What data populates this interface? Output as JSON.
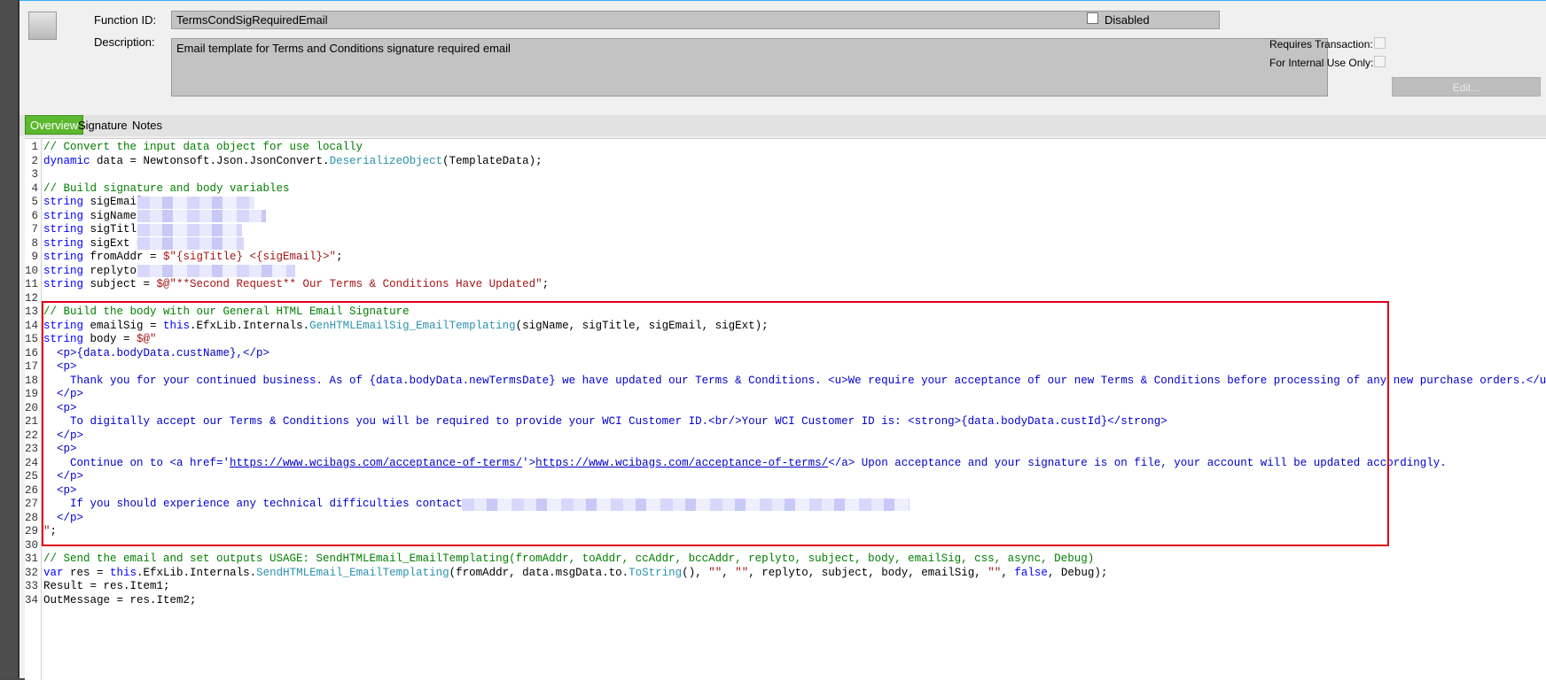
{
  "header": {
    "function_id_label": "Function ID:",
    "function_id_value": "TermsCondSigRequiredEmail",
    "disabled_label": "Disabled",
    "description_label": "Description:",
    "description_value": "Email template for Terms and Conditions signature required email",
    "requires_transaction_label": "Requires Transaction:",
    "internal_use_label": "For Internal Use Only:",
    "edit_button_label": "Edit..."
  },
  "tabs": [
    {
      "label": "Overview",
      "active": true
    },
    {
      "label": "Signature",
      "active": false
    },
    {
      "label": "Notes",
      "active": false
    }
  ],
  "code_lines": [
    {
      "n": "1"
    },
    {
      "n": "2"
    },
    {
      "n": "3"
    },
    {
      "n": "4"
    },
    {
      "n": "5"
    },
    {
      "n": "6"
    },
    {
      "n": "7"
    },
    {
      "n": "8"
    },
    {
      "n": "9"
    },
    {
      "n": "10"
    },
    {
      "n": "11"
    },
    {
      "n": "12"
    },
    {
      "n": "13"
    },
    {
      "n": "14"
    },
    {
      "n": "15"
    },
    {
      "n": "16"
    },
    {
      "n": "17"
    },
    {
      "n": "18"
    },
    {
      "n": "19"
    },
    {
      "n": "20"
    },
    {
      "n": "21"
    },
    {
      "n": "22"
    },
    {
      "n": "23"
    },
    {
      "n": "24"
    },
    {
      "n": "25"
    },
    {
      "n": "26"
    },
    {
      "n": "27"
    },
    {
      "n": "28"
    },
    {
      "n": "29"
    },
    {
      "n": "30"
    },
    {
      "n": "31"
    },
    {
      "n": "32"
    },
    {
      "n": "33"
    },
    {
      "n": "34"
    }
  ],
  "code": {
    "l1": "// Convert the input data object for use locally",
    "l2_kw": "dynamic",
    "l2_a": " data = Newtonsoft.Json.JsonConvert.",
    "l2_m": "DeserializeObject",
    "l2_b": "(TemplateData);",
    "l4": "// Build signature and body variables",
    "kw_string": "string",
    "l5": " sigEmail",
    "l6": " sigName =",
    "l7": " sigTitle",
    "l8": " sigExt =",
    "l9_a": " fromAddr = ",
    "l9_s": "$\"{sigTitle} <{sigEmail}>\"",
    "l9_b": ";",
    "l10": " replyto =",
    "l11_a": " subject = ",
    "l11_s": "$@\"**Second Request** Our Terms & Conditions Have Updated\"",
    "l11_b": ";",
    "l13": "// Build the body with our General HTML Email Signature",
    "l14_a": " emailSig = ",
    "kw_this": "this",
    "l14_b": ".EfxLib.Internals.",
    "l14_m": "GenHTMLEmailSig_EmailTemplating",
    "l14_c": "(sigName, sigTitle, sigEmail, sigExt);",
    "l15_a": " body = ",
    "l15_s": "$@\"",
    "l16": "  <p>{data.bodyData.custName},</p>",
    "l17": "  <p>",
    "l18": "    Thank you for your continued business. As of {data.bodyData.newTermsDate} we have updated our Terms & Conditions. <u>We require your acceptance of our new Terms & Conditions before processing of any new purchase orders.</u>",
    "l19": "  </p>",
    "l20": "  <p>",
    "l21": "    To digitally accept our Terms & Conditions you will be required to provide your WCI Customer ID.<br/>Your WCI Customer ID is: <strong>{data.bodyData.custId}</strong>",
    "l22": "  </p>",
    "l23": "  <p>",
    "l24_a": "    Continue on to <a href='",
    "l24_u1": "https://www.wcibags.com/acceptance-of-terms/",
    "l24_b": "'>",
    "l24_u2": "https://www.wcibags.com/acceptance-of-terms/",
    "l24_c": "</a> Upon acceptance and your signature is on file, your account will be updated accordingly.",
    "l25": "  </p>",
    "l26": "  <p>",
    "l27": "    If you should experience any technical difficulties contact",
    "l28": "  </p>",
    "l29_s": "\"",
    "l29_b": ";",
    "l31": "// Send the email and set outputs USAGE: SendHTMLEmail_EmailTemplating(fromAddr, toAddr, ccAddr, bccAddr, replyto, subject, body, emailSig, css, async, Debug)",
    "kw_var": "var",
    "l32_a": " res = ",
    "l32_b": ".EfxLib.Internals.",
    "l32_m": "SendHTMLEmail_EmailTemplating",
    "l32_c": "(fromAddr, data.msgData.to.",
    "l32_m2": "ToString",
    "l32_d": "(), ",
    "l32_s1": "\"\"",
    "l32_e": ", ",
    "l32_s2": "\"\"",
    "l32_f": ", replyto, subject, body, emailSig, ",
    "l32_s3": "\"\"",
    "l32_g": ", ",
    "kw_false": "false",
    "l32_h": ", Debug);",
    "l33": "Result = res.Item1;",
    "l34": "OutMessage = res.Item2;"
  }
}
